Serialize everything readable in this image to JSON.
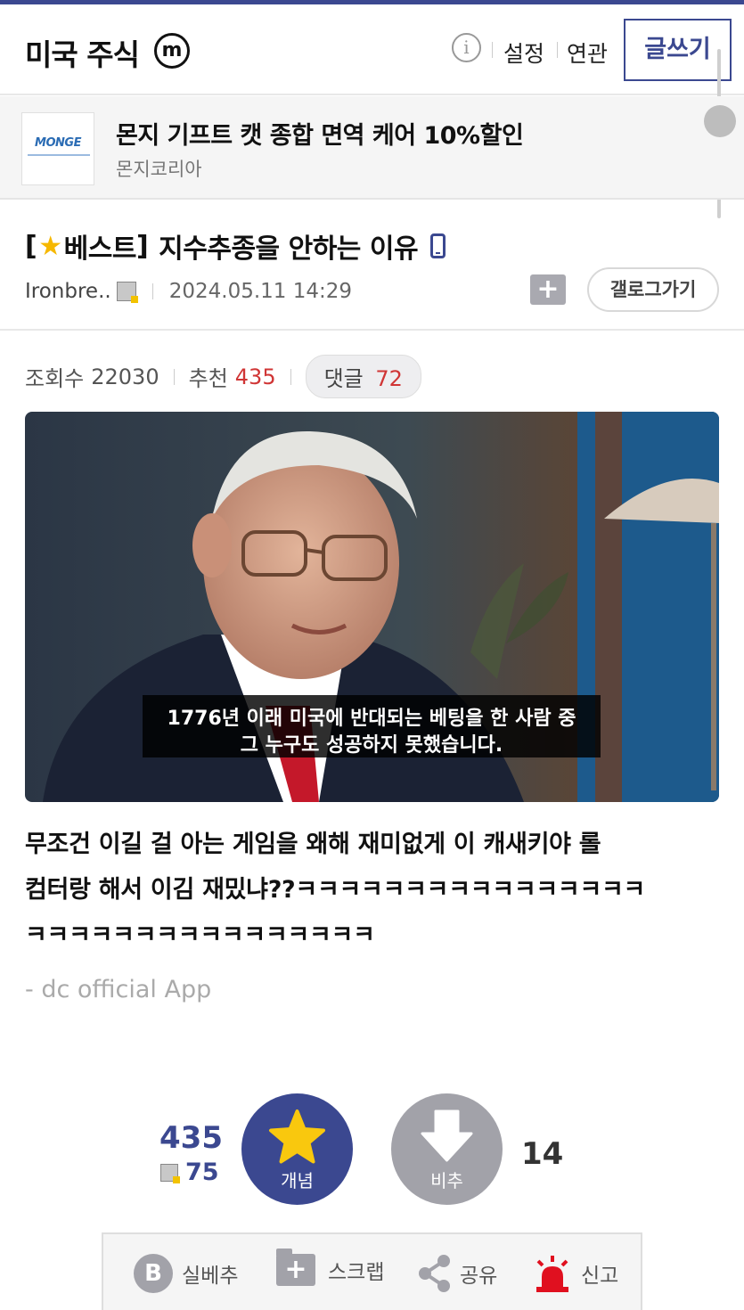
{
  "header": {
    "gallery_title": "미국 주식",
    "gallery_badge": "m",
    "info_icon": "i",
    "settings_label": "설정",
    "related_label": "연관",
    "write_label": "글쓰기"
  },
  "ad": {
    "logo_text": "MONGE",
    "title": "몬지 기프트 캣 종합 면역 케어 10%할인",
    "advertiser": "몬지코리아"
  },
  "post": {
    "title_prefix_open": "[",
    "title_badge": "베스트",
    "title_prefix_close": "]",
    "title": "지수추종을 안하는 이유",
    "author": "Ironbre..",
    "date": "2024.05.11 14:29",
    "gallery_go_label": "갤로그가기",
    "views_label": "조회수",
    "views": "22030",
    "recommend_label": "추천",
    "recommend": "435",
    "comments_label": "댓글",
    "comments": "72",
    "image_subtitle_line1": "1776년 이래 미국에 반대되는 베팅을 한 사람 중",
    "image_subtitle_line2": "그 누구도 성공하지 못했습니다.",
    "body_line1": "무조건 이길 걸 아는 게임을 왜해 재미없게 이 캐새키야  롤",
    "body_line2": "컴터랑 해서 이김 재밌냐??ㅋㅋㅋㅋㅋㅋㅋㅋㅋㅋㅋㅋㅋㅋㅋㅋ",
    "body_line3": "ㅋㅋㅋㅋㅋㅋㅋㅋㅋㅋㅋㅋㅋㅋㅋㅋ",
    "app_signature": "- dc official App"
  },
  "vote": {
    "up_count": "435",
    "fixed_count": "75",
    "up_label": "개념",
    "down_label": "비추",
    "down_count": "14"
  },
  "actions": {
    "real_best_icon": "B",
    "real_best_label": "실베추",
    "scrap_label": "스크랩",
    "share_label": "공유",
    "report_label": "신고"
  },
  "colors": {
    "brand": "#3b4890",
    "accent_red": "#d03535",
    "neutral_button": "#a2a2a9"
  }
}
